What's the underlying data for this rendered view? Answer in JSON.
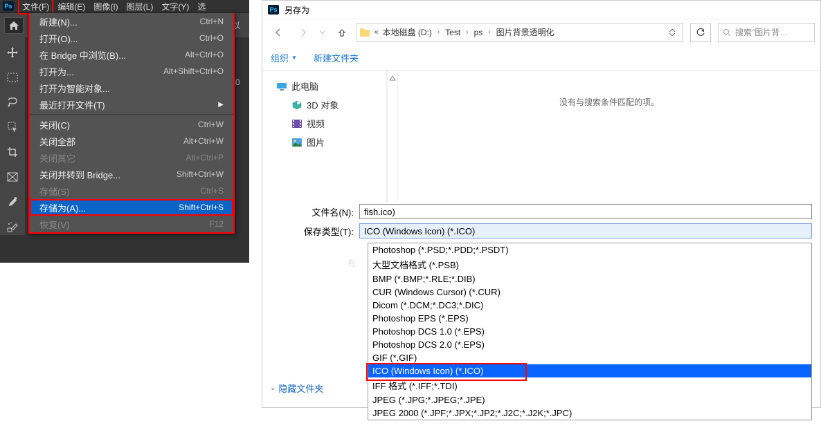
{
  "ps": {
    "menubar": [
      "文件(F)",
      "编辑(E)",
      "图像(I)",
      "图层(L)",
      "文字(Y)",
      "选"
    ],
    "options_hint": "以",
    "options_right": "0"
  },
  "file_menu": {
    "items": [
      {
        "label": "新建(N)...",
        "shortcut": "Ctrl+N"
      },
      {
        "label": "打开(O)...",
        "shortcut": "Ctrl+O"
      },
      {
        "label": "在 Bridge 中浏览(B)...",
        "shortcut": "Alt+Ctrl+O"
      },
      {
        "label": "打开为...",
        "shortcut": "Alt+Shift+Ctrl+O"
      },
      {
        "label": "打开为智能对象..."
      },
      {
        "label": "最近打开文件(T)",
        "submenu": true
      }
    ],
    "items2": [
      {
        "label": "关闭(C)",
        "shortcut": "Ctrl+W"
      },
      {
        "label": "关闭全部",
        "shortcut": "Alt+Ctrl+W"
      },
      {
        "label": "关闭其它",
        "shortcut": "Alt+Ctrl+P",
        "disabled": true
      },
      {
        "label": "关闭并转到 Bridge...",
        "shortcut": "Shift+Ctrl+W"
      },
      {
        "label": "存储(S)",
        "shortcut": "Ctrl+S",
        "disabled": true
      },
      {
        "label": "存储为(A)...",
        "shortcut": "Shift+Ctrl+S",
        "selected": true
      },
      {
        "label": "恢复(V)",
        "shortcut": "F12",
        "disabled": true
      }
    ]
  },
  "saveas": {
    "title": "另存为",
    "breadcrumb": [
      "本地磁盘 (D:)",
      "Test",
      "ps",
      "图片背景透明化"
    ],
    "search_placeholder": "搜索\"图片背…",
    "toolbar": {
      "organize": "组织",
      "new_folder": "新建文件夹"
    },
    "tree": {
      "root": "此电脑",
      "children": [
        "3D 对象",
        "视频",
        "图片"
      ]
    },
    "results_empty": "没有与搜索条件匹配的项。",
    "filename_label": "文件名(N):",
    "filename_value": "fish.ico)",
    "type_label": "保存类型(T):",
    "type_value": "ICO (Windows Icon) (*.ICO)",
    "hide_folders": "隐藏文件夹",
    "partial_text": "有",
    "formats": [
      "Photoshop (*.PSD;*.PDD;*.PSDT)",
      "大型文档格式 (*.PSB)",
      "BMP (*.BMP;*.RLE;*.DIB)",
      "CUR (Windows Cursor) (*.CUR)",
      "Dicom (*.DCM;*.DC3;*.DIC)",
      "Photoshop EPS (*.EPS)",
      "Photoshop DCS 1.0 (*.EPS)",
      "Photoshop DCS 2.0 (*.EPS)",
      "GIF (*.GIF)",
      "ICO (Windows Icon) (*.ICO)",
      "IFF 格式 (*.IFF;*.TDI)",
      "JPEG (*.JPG;*.JPEG;*.JPE)",
      "JPEG 2000 (*.JPF;*.JPX;*.JP2;*.J2C;*.J2K;*.JPC)"
    ],
    "selected_format_index": 9
  }
}
